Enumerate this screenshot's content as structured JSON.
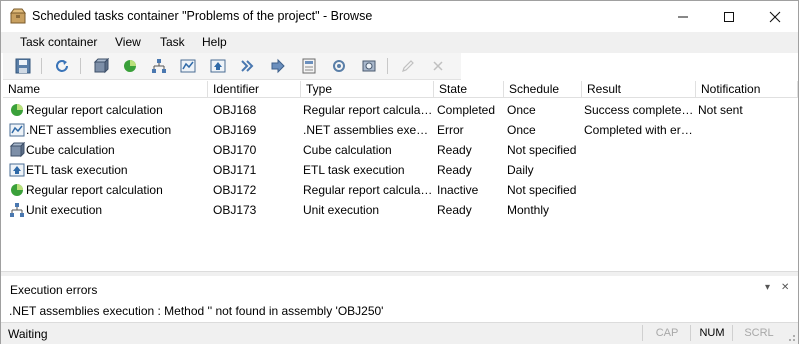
{
  "window": {
    "title": "Scheduled tasks container \"Problems of the project\" - Browse"
  },
  "menu": [
    "Task container",
    "View",
    "Task",
    "Help"
  ],
  "toolbar": {
    "buttons": [
      "save-icon",
      "refresh-icon",
      "cube-icon",
      "report-icon",
      "unit-icon",
      "net-assembly-icon",
      "etl-icon",
      "script-icon",
      "forward-icon",
      "document-icon",
      "cycle-icon",
      "settings-icon",
      "edit-icon",
      "delete-icon"
    ]
  },
  "table": {
    "columns": [
      "Name",
      "Identifier",
      "Type",
      "State",
      "Schedule",
      "Result",
      "Notification"
    ],
    "rows": [
      {
        "icon": "report-icon",
        "name": "Regular report calculation",
        "id": "OBJ168",
        "type": "Regular report calculation",
        "state": "Completed",
        "schedule": "Once",
        "result": "Success completed ...",
        "notification": "Not sent"
      },
      {
        "icon": "net-assembly-icon",
        "name": ".NET assemblies execution",
        "id": "OBJ169",
        "type": ".NET assemblies execution",
        "state": "Error",
        "schedule": "Once",
        "result": "Completed with err...",
        "notification": ""
      },
      {
        "icon": "cube-icon",
        "name": "Cube calculation",
        "id": "OBJ170",
        "type": "Cube calculation",
        "state": "Ready",
        "schedule": "Not specified",
        "result": "",
        "notification": ""
      },
      {
        "icon": "etl-icon",
        "name": "ETL task execution",
        "id": "OBJ171",
        "type": "ETL task execution",
        "state": "Ready",
        "schedule": "Daily",
        "result": "",
        "notification": ""
      },
      {
        "icon": "report-icon",
        "name": "Regular report calculation",
        "id": "OBJ172",
        "type": "Regular report calculation",
        "state": "Inactive",
        "schedule": "Not specified",
        "result": "",
        "notification": ""
      },
      {
        "icon": "unit-icon",
        "name": "Unit execution",
        "id": "OBJ173",
        "type": "Unit execution",
        "state": "Ready",
        "schedule": "Monthly",
        "result": "",
        "notification": ""
      }
    ]
  },
  "errors": {
    "title": "Execution errors",
    "message": ".NET assemblies execution : Method '' not found in assembly 'OBJ250'"
  },
  "status": {
    "text": "Waiting",
    "cap": "CAP",
    "num": "NUM",
    "scrl": "SCRL"
  }
}
